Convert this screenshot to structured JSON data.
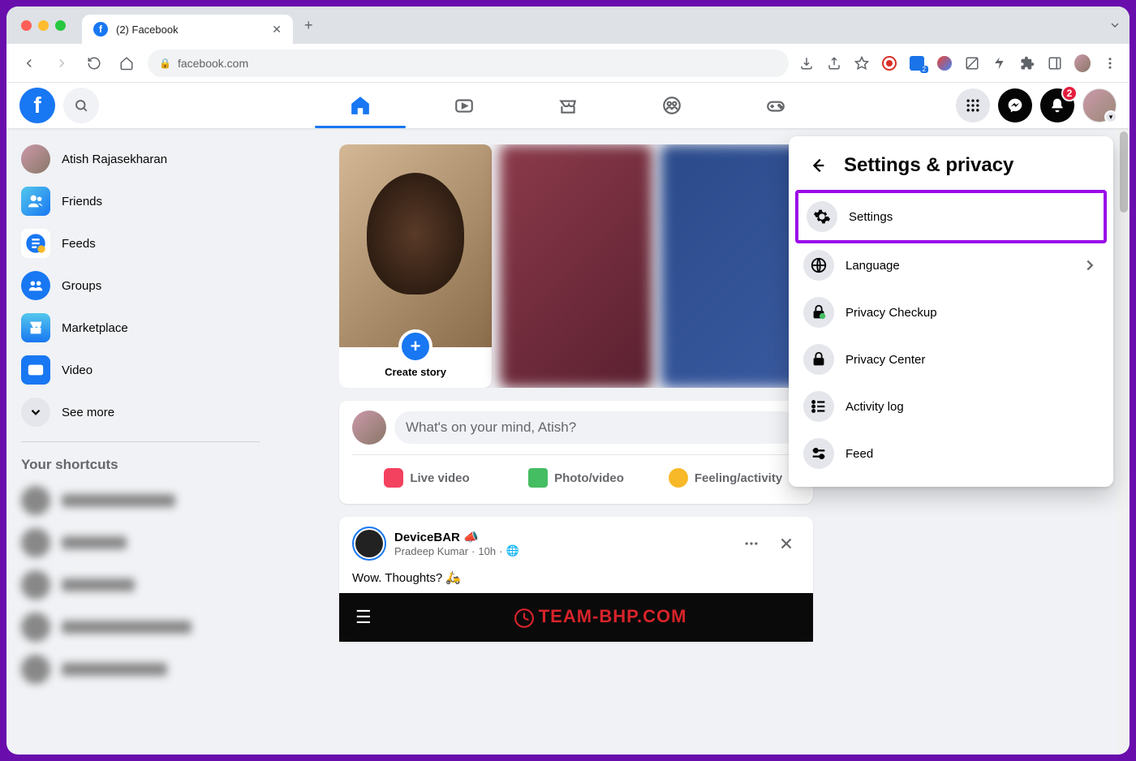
{
  "browser": {
    "tab_title": "(2) Facebook",
    "url": "facebook.com",
    "notification_badge": "2"
  },
  "header": {
    "notifications_count": "2"
  },
  "sidebar": {
    "items": [
      {
        "label": "Atish Rajasekharan"
      },
      {
        "label": "Friends"
      },
      {
        "label": "Feeds"
      },
      {
        "label": "Groups"
      },
      {
        "label": "Marketplace"
      },
      {
        "label": "Video"
      },
      {
        "label": "See more"
      }
    ],
    "shortcuts_title": "Your shortcuts"
  },
  "stories": {
    "create_label": "Create story"
  },
  "composer": {
    "placeholder": "What's on your mind, Atish?",
    "live_video": "Live video",
    "photo_video": "Photo/video",
    "feeling": "Feeling/activity"
  },
  "post": {
    "page_name": "DeviceBAR",
    "author": "Pradeep Kumar",
    "time": "10h",
    "text": "Wow. Thoughts? 🛵",
    "img_logo": "TEAM-BHP.COM"
  },
  "popup": {
    "title": "Settings & privacy",
    "items": [
      {
        "label": "Settings",
        "highlight": true
      },
      {
        "label": "Language",
        "chevron": true
      },
      {
        "label": "Privacy Checkup"
      },
      {
        "label": "Privacy Center"
      },
      {
        "label": "Activity log"
      },
      {
        "label": "Feed"
      }
    ]
  }
}
